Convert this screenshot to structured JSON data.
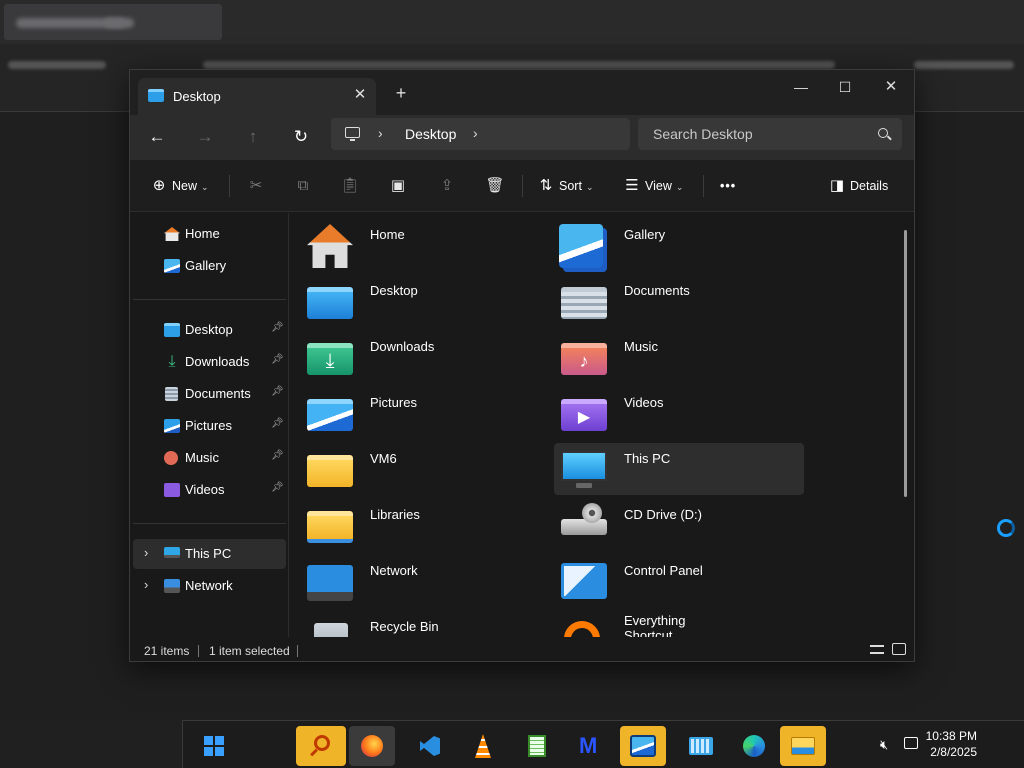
{
  "window": {
    "tab_title": "Desktop",
    "tab_close": "✕",
    "new_tab": "+",
    "minimize": "—",
    "maximize": "☐",
    "close": "✕"
  },
  "nav": {
    "back": "←",
    "forward": "→",
    "up": "↑",
    "refresh": "↻",
    "breadcrumb": [
      "Desktop"
    ],
    "search_placeholder": "Search Desktop"
  },
  "toolbar": {
    "new_label": "New",
    "sort_label": "Sort",
    "view_label": "View",
    "more_label": "•••",
    "details_label": "Details"
  },
  "sidebar": {
    "top": [
      {
        "label": "Home",
        "icon": "home-icon"
      },
      {
        "label": "Gallery",
        "icon": "gallery-icon"
      }
    ],
    "quick_access": [
      {
        "label": "Desktop",
        "icon": "desktop-folder-icon"
      },
      {
        "label": "Downloads",
        "icon": "downloads-icon"
      },
      {
        "label": "Documents",
        "icon": "documents-icon"
      },
      {
        "label": "Pictures",
        "icon": "pictures-icon"
      },
      {
        "label": "Music",
        "icon": "music-icon"
      },
      {
        "label": "Videos",
        "icon": "videos-icon"
      }
    ],
    "tree": [
      {
        "label": "This PC",
        "icon": "this-pc-icon",
        "selected": true
      },
      {
        "label": "Network",
        "icon": "network-icon"
      }
    ]
  },
  "content": {
    "items": [
      {
        "name": "Home"
      },
      {
        "name": "Gallery"
      },
      {
        "name": "Desktop"
      },
      {
        "name": "Documents"
      },
      {
        "name": "Downloads"
      },
      {
        "name": "Music"
      },
      {
        "name": "Pictures"
      },
      {
        "name": "Videos"
      },
      {
        "name": "VM6"
      },
      {
        "name": "This PC",
        "selected": true
      },
      {
        "name": "Libraries"
      },
      {
        "name": "CD Drive (D:)"
      },
      {
        "name": "Network"
      },
      {
        "name": "Control Panel"
      },
      {
        "name": "Recycle Bin"
      },
      {
        "name": "Everything\nShortcut"
      }
    ]
  },
  "status": {
    "item_count": "21 items",
    "selection": "1 item selected"
  },
  "taskbar": {
    "time": "10:38 PM",
    "date": "2/8/2025"
  },
  "colors": {
    "accent": "#0078d4",
    "folder_yellow": "#f7c948",
    "taskbar_highlight": "#f0b429"
  }
}
